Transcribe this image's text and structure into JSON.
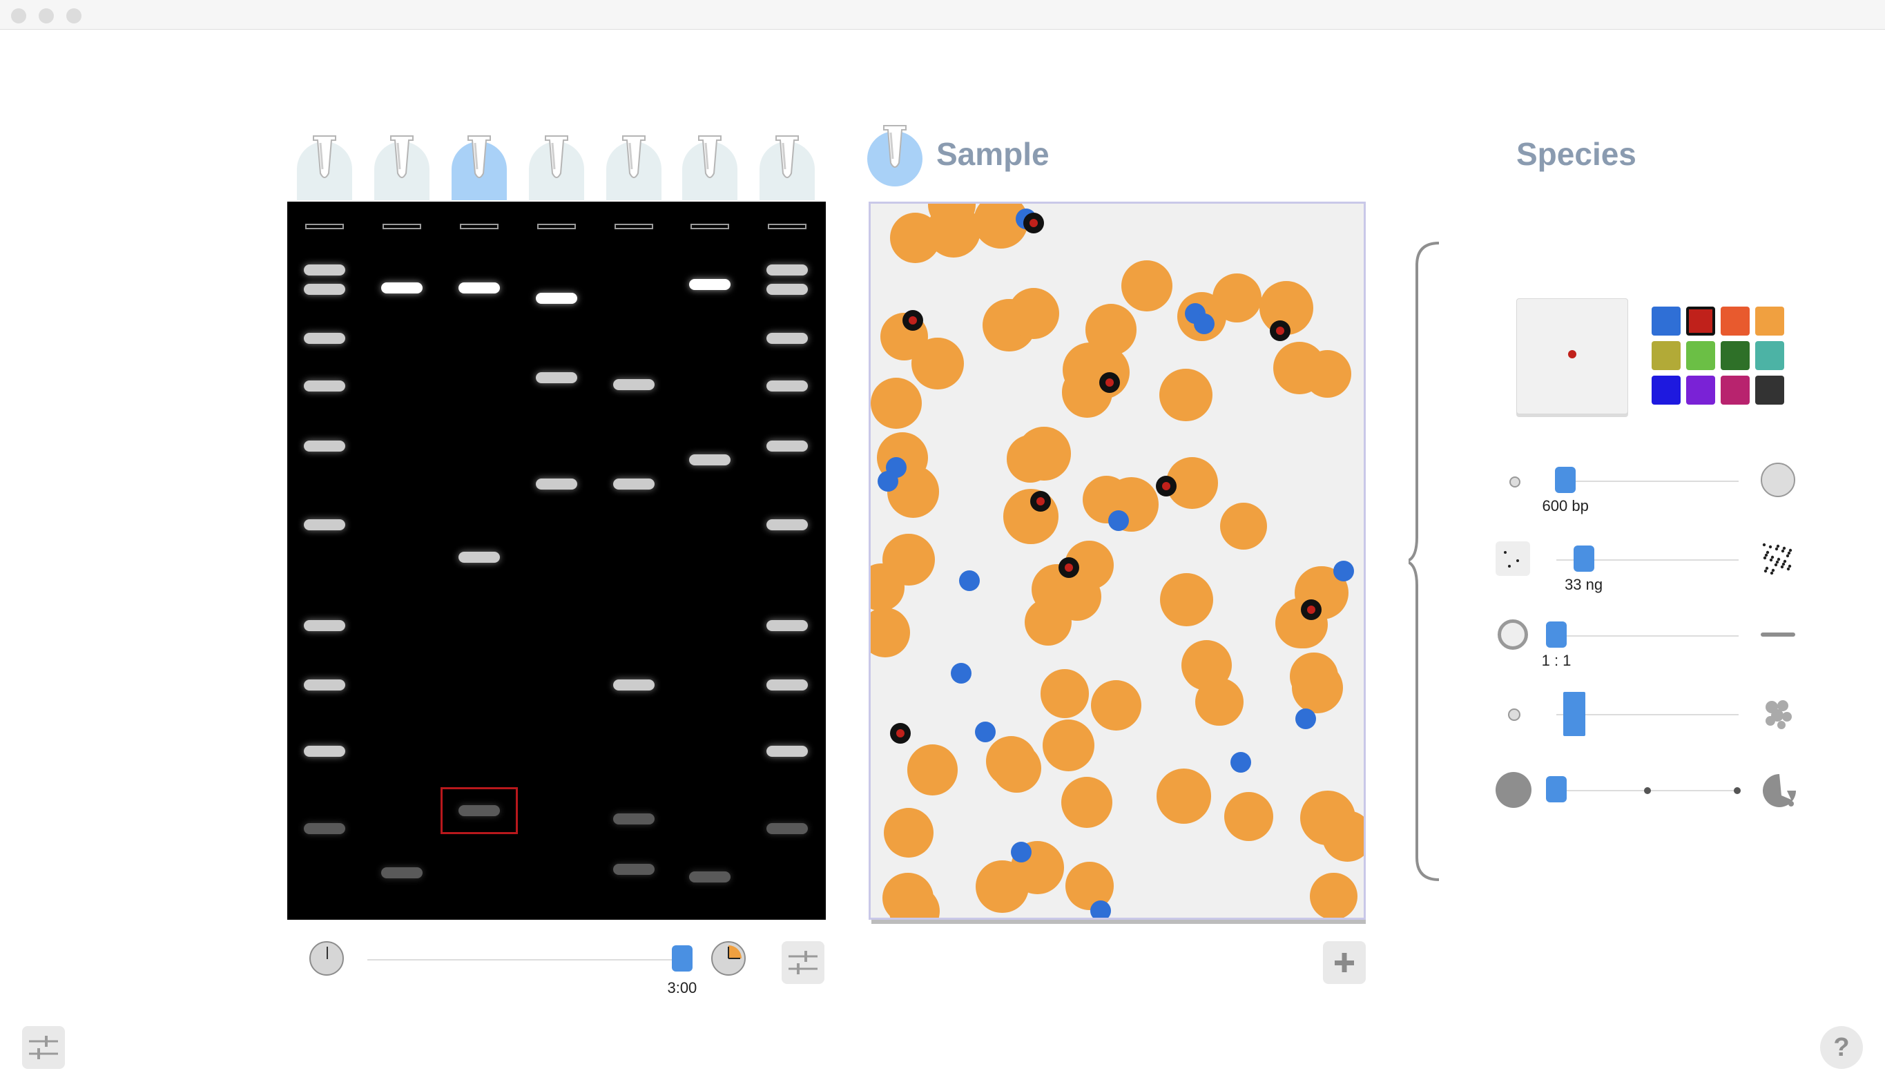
{
  "window": {
    "title": ""
  },
  "gel": {
    "lane_count": 7,
    "selected_lane_index": 2,
    "lanes": [
      {
        "bands": [
          0.095,
          0.122,
          0.19,
          0.257,
          0.34,
          0.45,
          0.59,
          0.673,
          0.765,
          0.873
        ],
        "bright": "medium"
      },
      {
        "bands": [
          0.12,
          0.935
        ],
        "bright": "high"
      },
      {
        "bands": [
          0.12,
          0.495,
          0.848
        ],
        "bright": "high"
      },
      {
        "bands": [
          0.135,
          0.245,
          0.393
        ],
        "bright": "high"
      },
      {
        "bands": [
          0.255,
          0.393,
          0.673,
          0.86,
          0.93
        ],
        "bright": "medium"
      },
      {
        "bands": [
          0.115,
          0.36,
          0.94
        ],
        "bright": "high"
      },
      {
        "bands": [
          0.095,
          0.122,
          0.19,
          0.257,
          0.34,
          0.45,
          0.59,
          0.673,
          0.765,
          0.873
        ],
        "bright": "medium"
      }
    ],
    "selected_band": {
      "lane_index": 2,
      "band_position": 0.848
    }
  },
  "timeline": {
    "time_label": "3:00",
    "progress": 0.97,
    "start_icon": "clock-start-icon",
    "end_icon": "clock-end-icon",
    "settings_icon": "sliders-icon"
  },
  "sample": {
    "title": "Sample",
    "add_button_icon": "plus-icon"
  },
  "species": {
    "title": "Species",
    "preview_icon": "species-preview-icon",
    "selected_color": "#c0211b",
    "colors": [
      "#2f6fd6",
      "#c0211b",
      "#e85a2e",
      "#f0a040",
      "#b2aa37",
      "#6bbf45",
      "#2e7028",
      "#4cb3a5",
      "#1e19df",
      "#7a22d6",
      "#b8236e",
      "#333333"
    ],
    "controls": [
      {
        "name": "size",
        "label": "600 bp",
        "value": 0.05,
        "min_icon": "small-circle-icon",
        "max_icon": "large-circle-icon"
      },
      {
        "name": "concentration",
        "label": "33 ng",
        "value": 0.15,
        "min_icon": "sparse-dots-icon",
        "max_icon": "dense-dots-icon"
      },
      {
        "name": "shape",
        "label": "1 : 1",
        "value": 0.0,
        "min_icon": "ring-icon",
        "max_icon": "line-icon"
      },
      {
        "name": "aggregation",
        "label": "",
        "value": 0.1,
        "min_icon": "dot-icon",
        "max_icon": "cluster-icon"
      },
      {
        "name": "degradation",
        "label": "",
        "value": 0.0,
        "min_icon": "filled-circle-icon",
        "max_icon": "fragmented-circle-icon"
      }
    ]
  },
  "footer": {
    "settings_icon": "sliders-icon",
    "help_label": "?"
  },
  "colors": {
    "accent": "#4a90e2",
    "orange": "#f0a040",
    "blue_particle": "#2f6fd6",
    "title_gray": "#8a9bb0"
  }
}
